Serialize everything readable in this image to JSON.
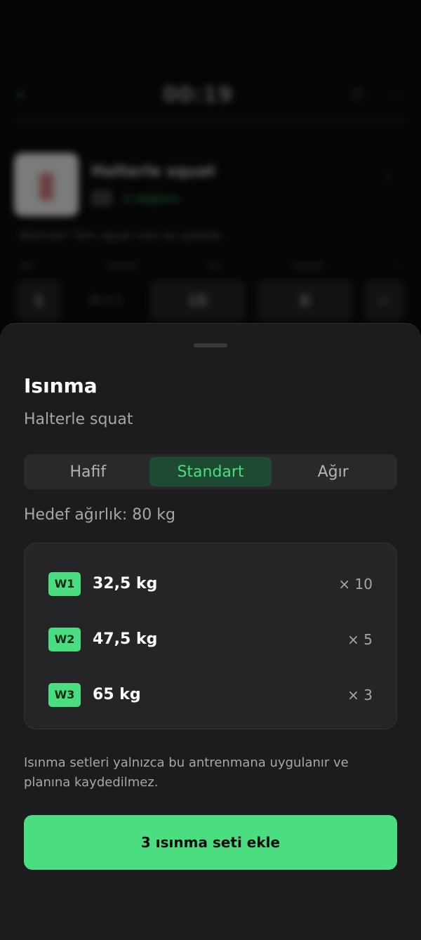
{
  "background": {
    "timer": "00:19",
    "exercise_name": "Halterle squat",
    "exercise_tag": "Ü dağılımı",
    "note": "Bilimsel? Tüm squat notu bu şekilde.",
    "columns": [
      "SET",
      "ÖNCEKİ",
      "KG",
      "TEKRAR",
      "✓"
    ],
    "row": {
      "set": "1",
      "prev": "15 × 1",
      "kg": "15",
      "reps": "6",
      "check": "✓"
    },
    "icons": {
      "back": "back-arrow-icon",
      "timer_action": "stopwatch-icon",
      "menu": "more-icon"
    }
  },
  "sheet": {
    "title": "Isınma",
    "subtitle": "Halterle squat",
    "tabs": [
      "Hafif",
      "Standart",
      "Ağır"
    ],
    "active_tab": "Standart",
    "target": "Hedef ağırlık: 80 kg",
    "sets": [
      {
        "badge": "W1",
        "weight": "32,5 kg",
        "reps": "× 10"
      },
      {
        "badge": "W2",
        "weight": "47,5 kg",
        "reps": "× 5"
      },
      {
        "badge": "W3",
        "weight": "65 kg",
        "reps": "× 3"
      }
    ],
    "info": "Isınma setleri yalnızca bu antrenmana uygulanır ve planına kaydedilmez.",
    "cta": "3 ısınma seti ekle"
  },
  "colors": {
    "accent": "#4ade80",
    "sheet_bg": "#1c1c1e",
    "card_bg": "#252528",
    "active_tab_bg": "#1f4a32"
  }
}
